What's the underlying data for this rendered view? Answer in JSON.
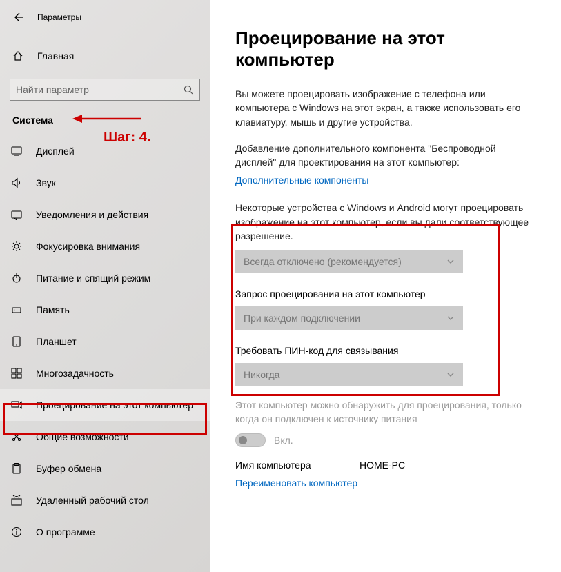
{
  "header": {
    "title": "Параметры"
  },
  "home": {
    "label": "Главная"
  },
  "search": {
    "placeholder": "Найти параметр"
  },
  "category": "Система",
  "annotation": {
    "step_label": "Шаг: 4."
  },
  "nav": [
    {
      "key": "display",
      "label": "Дисплей"
    },
    {
      "key": "sound",
      "label": "Звук"
    },
    {
      "key": "notif",
      "label": "Уведомления и действия"
    },
    {
      "key": "focus",
      "label": "Фокусировка внимания"
    },
    {
      "key": "power",
      "label": "Питание и спящий режим"
    },
    {
      "key": "storage",
      "label": "Память"
    },
    {
      "key": "tablet",
      "label": "Планшет"
    },
    {
      "key": "multi",
      "label": "Многозадачность"
    },
    {
      "key": "project",
      "label": "Проецирование на этот компьютер",
      "active": true
    },
    {
      "key": "shared",
      "label": "Общие возможности"
    },
    {
      "key": "clipboard",
      "label": "Буфер обмена"
    },
    {
      "key": "remote",
      "label": "Удаленный рабочий стол"
    },
    {
      "key": "about",
      "label": "О программе"
    }
  ],
  "main": {
    "title": "Проецирование на этот компьютер",
    "intro": "Вы можете проецировать изображение с телефона или компьютера с Windows на этот экран, а также использовать его клавиатуру, мышь и другие устройства.",
    "addon_text": "Добавление дополнительного компонента \"Беспроводной дисплей\" для проектирования на этот компьютер:",
    "addon_link": "Дополнительные компоненты",
    "permission_text": "Некоторые устройства с Windows и Android могут проецировать изображение на этот компьютер, если вы дали соответствующее разрешение.",
    "dropdown1": "Всегда отключено (рекомендуется)",
    "label2": "Запрос проецирования на этот компьютер",
    "dropdown2": "При каждом подключении",
    "label3": "Требовать ПИН-код для связывания",
    "dropdown3": "Никогда",
    "power_note": "Этот компьютер можно обнаружить для проецирования, только когда он подключен к источнику питания",
    "toggle_label": "Вкл.",
    "pcname_label": "Имя компьютера",
    "pcname_value": "HOME-PC",
    "rename_link": "Переименовать компьютер"
  }
}
